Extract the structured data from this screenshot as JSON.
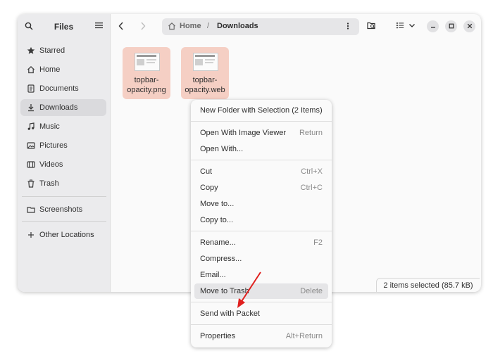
{
  "app": {
    "title": "Files"
  },
  "sidebar": {
    "items": [
      {
        "label": "Starred",
        "icon": "star-icon"
      },
      {
        "label": "Home",
        "icon": "home-icon"
      },
      {
        "label": "Documents",
        "icon": "document-icon"
      },
      {
        "label": "Downloads",
        "icon": "download-icon",
        "active": true
      },
      {
        "label": "Music",
        "icon": "music-icon"
      },
      {
        "label": "Pictures",
        "icon": "picture-icon"
      },
      {
        "label": "Videos",
        "icon": "video-icon"
      },
      {
        "label": "Trash",
        "icon": "trash-icon"
      }
    ],
    "extra": [
      {
        "label": "Screenshots",
        "icon": "folder-icon"
      },
      {
        "label": "Other Locations",
        "icon": "plus-icon"
      }
    ]
  },
  "pathbar": {
    "home": "Home",
    "separator": "/",
    "current": "Downloads"
  },
  "files": [
    {
      "name_line1": "topbar-",
      "name_line2": "opacity.png"
    },
    {
      "name_line1": "topbar-",
      "name_line2": "opacity.web"
    }
  ],
  "status": {
    "text": "2 items selected  (85.7 kB)"
  },
  "context_menu": {
    "groups": [
      [
        {
          "label": "New Folder with Selection (2 Items)",
          "shortcut": ""
        }
      ],
      [
        {
          "label": "Open With Image Viewer",
          "shortcut": "Return"
        },
        {
          "label": "Open With...",
          "shortcut": ""
        }
      ],
      [
        {
          "label": "Cut",
          "shortcut": "Ctrl+X"
        },
        {
          "label": "Copy",
          "shortcut": "Ctrl+C"
        },
        {
          "label": "Move to...",
          "shortcut": ""
        },
        {
          "label": "Copy to...",
          "shortcut": ""
        }
      ],
      [
        {
          "label": "Rename...",
          "shortcut": "F2"
        },
        {
          "label": "Compress...",
          "shortcut": ""
        },
        {
          "label": "Email...",
          "shortcut": ""
        },
        {
          "label": "Move to Trash",
          "shortcut": "Delete",
          "hover": true
        }
      ],
      [
        {
          "label": "Send with Packet",
          "shortcut": ""
        }
      ],
      [
        {
          "label": "Properties",
          "shortcut": "Alt+Return"
        }
      ]
    ]
  },
  "colors": {
    "selection": "#f5cfc4",
    "annotation_arrow": "#e0201e"
  }
}
